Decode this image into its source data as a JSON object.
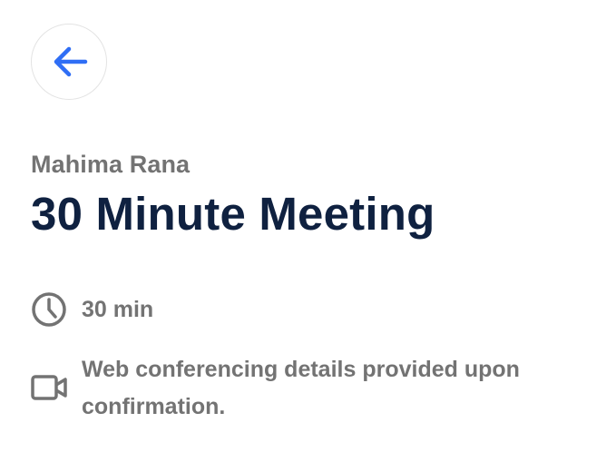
{
  "back_button": {
    "icon": "arrow-left-icon",
    "color": "#2f6ef5"
  },
  "organizer": {
    "name": "Mahima Rana"
  },
  "event": {
    "title": "30 Minute Meeting",
    "duration": {
      "icon": "clock-icon",
      "text": "30 min"
    },
    "location": {
      "icon": "video-camera-icon",
      "text": "Web conferencing details provided upon confirmation."
    }
  },
  "colors": {
    "title": "#0f2140",
    "secondary_text": "#737373",
    "accent": "#2f6ef5"
  }
}
